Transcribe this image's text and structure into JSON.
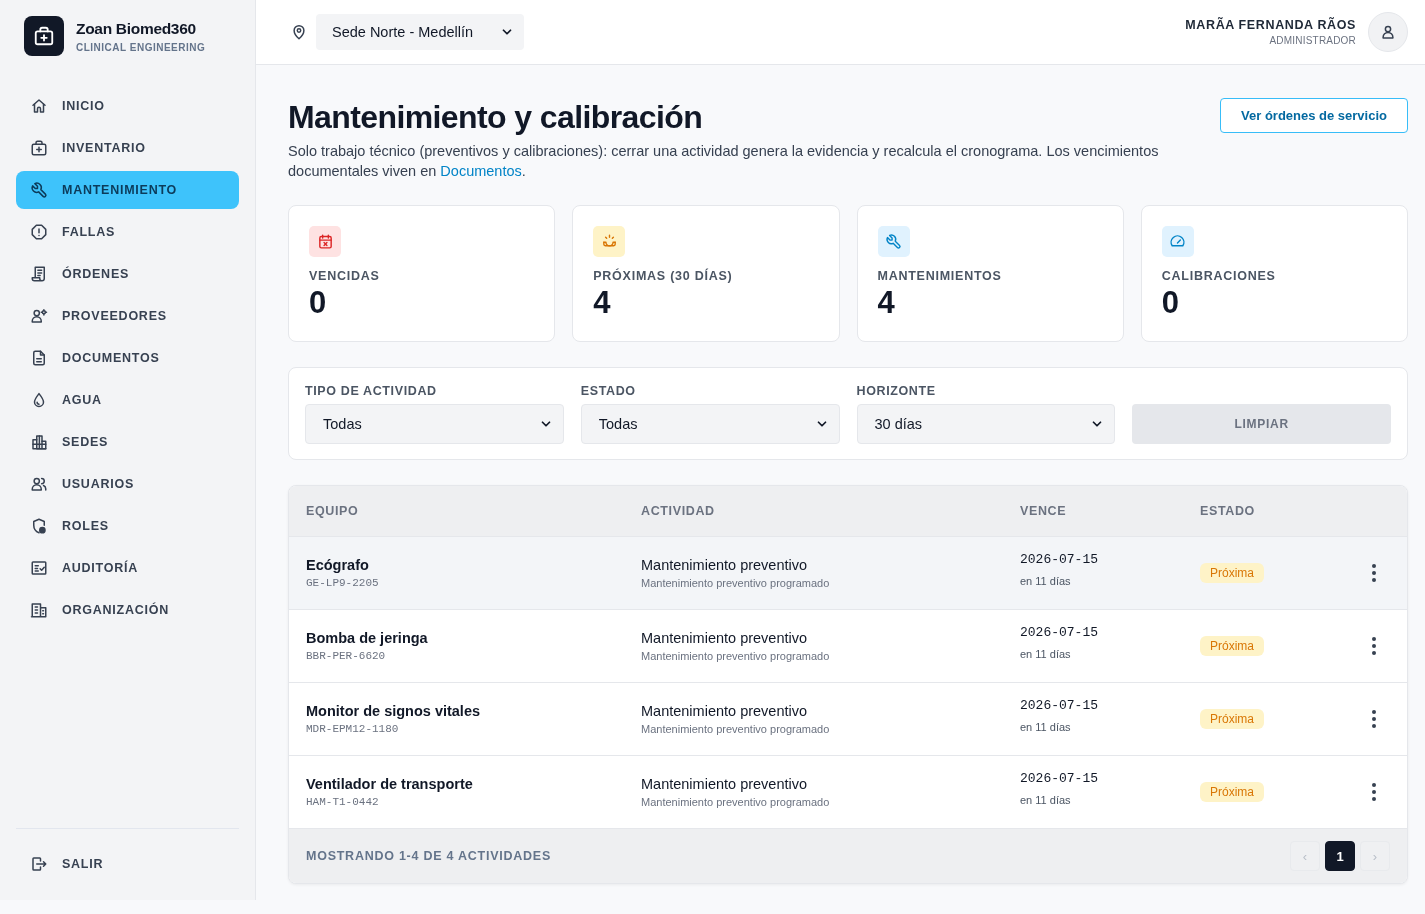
{
  "sidebar": {
    "brand": {
      "name": "Zoan Biomed360",
      "tagline": "CLINICAL ENGINEERING"
    },
    "nav_items": [
      {
        "label": "INICIO",
        "selected": false
      },
      {
        "label": "INVENTARIO",
        "selected": false
      },
      {
        "label": "MANTENIMIENTO",
        "selected": true
      },
      {
        "label": "FALLAS",
        "selected": false
      },
      {
        "label": "ÓRDENES",
        "selected": false
      },
      {
        "label": "PROVEEDORES",
        "selected": false
      },
      {
        "label": "DOCUMENTOS",
        "selected": false
      },
      {
        "label": "AGUA",
        "selected": false
      },
      {
        "label": "SEDES",
        "selected": false
      },
      {
        "label": "USUARIOS",
        "selected": false
      },
      {
        "label": "ROLES",
        "selected": false
      },
      {
        "label": "AUDITORÍA",
        "selected": false
      },
      {
        "label": "ORGANIZACIÓN",
        "selected": false
      }
    ],
    "logout": {
      "label": "SALIR"
    }
  },
  "topbar": {
    "site_select": {
      "value": "Sede Norte - Medellín"
    },
    "user": {
      "name": "MARÃA FERNANDA RÃOS",
      "role": "ADMINISTRADOR"
    }
  },
  "page_header": {
    "title": "Mantenimiento y calibración",
    "description": {
      "text": "Solo trabajo técnico (preventivos y calibraciones): cerrar una actividad genera la evidencia y recalcula el cronograma. Los vencimientos documentales viven en",
      "link": "Documentos",
      "end": "."
    },
    "action_button": "Ver órdenes de servicio"
  },
  "stats": [
    {
      "kind": "overdue",
      "label": "VENCIDAS",
      "value": "0"
    },
    {
      "kind": "upcoming",
      "label": "PRÓXIMAS (30 DÍAS)",
      "value": "4"
    },
    {
      "kind": "maintenance",
      "label": "MANTENIMIENTOS",
      "value": "4"
    },
    {
      "kind": "calibration",
      "label": "CALIBRACIONES",
      "value": "0"
    }
  ],
  "filters": {
    "fields": [
      {
        "label": "TIPO DE ACTIVIDAD",
        "value": "Todas"
      },
      {
        "label": "ESTADO",
        "value": "Todas"
      },
      {
        "label": "HORIZONTE",
        "value": "30 días"
      }
    ],
    "clear_button": {
      "label": "LIMPIAR",
      "disabled": true
    }
  },
  "table": {
    "columns": [
      "EQUIPO",
      "ACTIVIDAD",
      "VENCE",
      "ESTADO"
    ],
    "rows": [
      {
        "equipment": "Ecógrafo",
        "code": "GE-LP9-2205",
        "activity": "Mantenimiento preventivo",
        "activity_detail": "Mantenimiento preventivo programado",
        "due_date": "2026-07-15",
        "due_in": "en 11 días",
        "status": "Próxima",
        "selected": true
      },
      {
        "equipment": "Bomba de jeringa",
        "code": "BBR-PER-6620",
        "activity": "Mantenimiento preventivo",
        "activity_detail": "Mantenimiento preventivo programado",
        "due_date": "2026-07-15",
        "due_in": "en 11 días",
        "status": "Próxima",
        "selected": false
      },
      {
        "equipment": "Monitor de signos vitales",
        "code": "MDR-EPM12-1180",
        "activity": "Mantenimiento preventivo",
        "activity_detail": "Mantenimiento preventivo programado",
        "due_date": "2026-07-15",
        "due_in": "en 11 días",
        "status": "Próxima",
        "selected": false
      },
      {
        "equipment": "Ventilador de transporte",
        "code": "HAM-T1-0442",
        "activity": "Mantenimiento preventivo",
        "activity_detail": "Mantenimiento preventivo programado",
        "due_date": "2026-07-15",
        "due_in": "en 11 días",
        "status": "Próxima",
        "selected": false
      }
    ],
    "footer": {
      "summary": "MOSTRANDO 1-4 DE 4 ACTIVIDADES",
      "pagination": {
        "prev": {
          "label": "‹",
          "disabled": true
        },
        "pages": [
          {
            "label": "1",
            "selected": true
          }
        ],
        "next": {
          "label": "›",
          "disabled": true
        }
      }
    }
  }
}
